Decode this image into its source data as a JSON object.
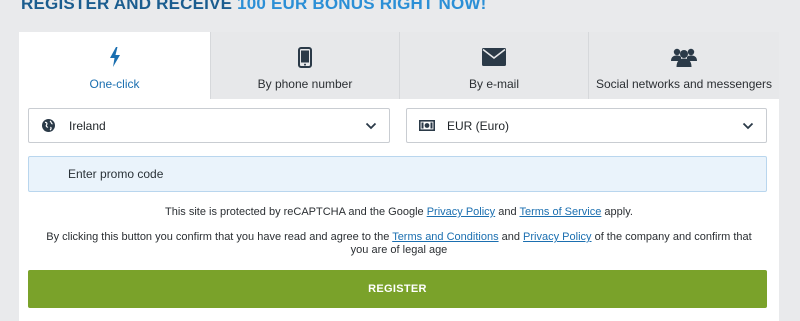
{
  "headline": {
    "part1": "REGISTER AND RECEIVE ",
    "part2": "100 EUR BONUS RIGHT NOW!"
  },
  "tabs": [
    {
      "label": "One-click",
      "icon": "lightning-icon",
      "active": true
    },
    {
      "label": "By phone number",
      "icon": "mobile-phone-icon",
      "active": false
    },
    {
      "label": "By e-mail",
      "icon": "envelope-icon",
      "active": false
    },
    {
      "label": "Social networks and messengers",
      "icon": "users-group-icon",
      "active": false
    }
  ],
  "country_select": {
    "value": "Ireland",
    "icon": "globe-icon"
  },
  "currency_select": {
    "value": "EUR (Euro)",
    "icon": "banknote-icon"
  },
  "promo": {
    "placeholder": "Enter promo code"
  },
  "recaptcha": {
    "text_before": "This site is protected by reCAPTCHA and the Google ",
    "privacy_link": "Privacy Policy",
    "text_and": " and ",
    "terms_link": "Terms of Service",
    "text_after": " apply."
  },
  "consent": {
    "text_before": "By clicking this button you confirm that you have read and agree to the ",
    "terms_link": "Terms and Conditions",
    "text_and": " and ",
    "privacy_link": "Privacy Policy",
    "text_after": " of the company and confirm that you are of legal age"
  },
  "register_button": {
    "label": "REGISTER"
  },
  "colors": {
    "brand_dark": "#1b5d8f",
    "brand_light": "#2b8fd6",
    "link": "#1b6fb0",
    "register": "#7aa22a",
    "promo_bg": "#eaf3fb"
  }
}
